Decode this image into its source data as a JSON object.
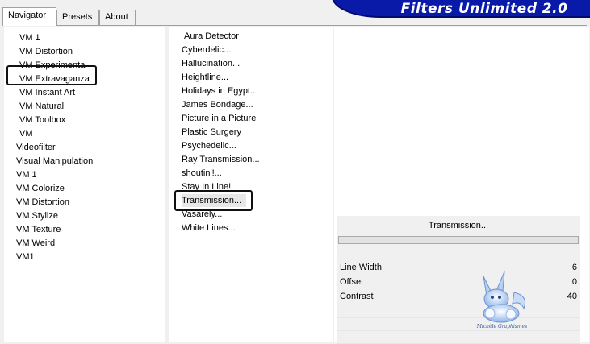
{
  "tabs": [
    {
      "label": "Navigator",
      "active": true
    },
    {
      "label": "Presets",
      "active": false
    },
    {
      "label": "About",
      "active": false
    }
  ],
  "banner": {
    "title": "Filters Unlimited 2.0"
  },
  "categories": [
    "VM 1",
    "VM Distortion",
    "VM Experimental",
    "VM Extravaganza",
    "VM Instant Art",
    "VM Natural",
    "VM Toolbox",
    "VM",
    "Videofilter",
    "Visual Manipulation",
    "VM 1",
    "VM Colorize",
    "VM Distortion",
    "VM Stylize",
    "VM Texture",
    "VM Weird",
    "VM1"
  ],
  "selected_category": "VM Extravaganza",
  "filters": [
    "Aura Detector",
    "Cyberdelic...",
    "Hallucination...",
    "Heightline...",
    "Holidays in Egypt..",
    "James Bondage...",
    "Picture in a Picture",
    "Plastic Surgery",
    "Psychedelic...",
    "Ray Transmission...",
    "shoutin'!...",
    "Stay In Line!",
    "Transmission...",
    "Vasarely...",
    "White Lines..."
  ],
  "selected_filter": "Transmission...",
  "parameters": {
    "title": "Transmission...",
    "rows": [
      {
        "label": "Line Width",
        "value": "6"
      },
      {
        "label": "Offset",
        "value": "0"
      },
      {
        "label": "Contrast",
        "value": "40"
      }
    ]
  },
  "watermark": {
    "text": "Michèle Graphismes"
  },
  "colors": {
    "banner": "#0a1aa8",
    "panel": "#ffffff",
    "frame": "#f0f0f0"
  }
}
